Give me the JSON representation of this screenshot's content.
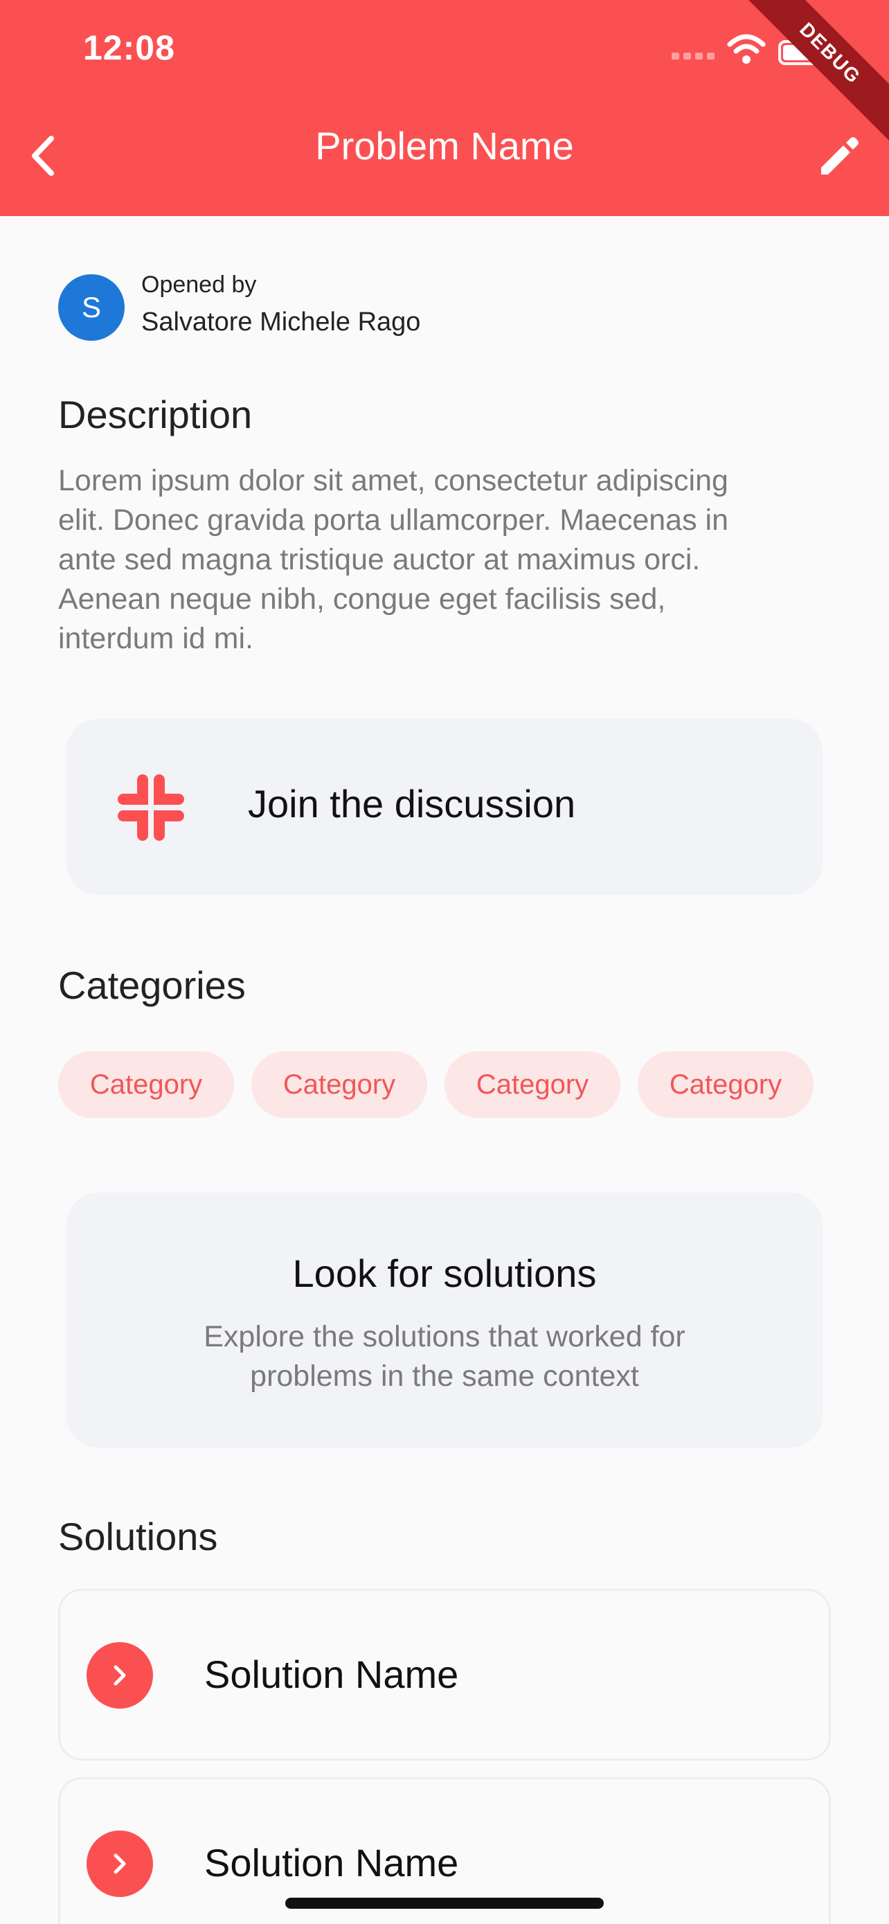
{
  "status_bar": {
    "time": "12:08"
  },
  "debug_banner": "DEBUG",
  "header": {
    "title": "Problem Name"
  },
  "opened_by": {
    "label": "Opened by",
    "avatar_initial": "S",
    "name": "Salvatore Michele Rago"
  },
  "description": {
    "title": "Description",
    "lines": [
      "Lorem ipsum dolor sit amet, consectetur adipiscing",
      "elit. Donec gravida porta ullamcorper. Maecenas in",
      "ante sed magna tristique auctor at maximus orci.",
      "Aenean neque nibh, congue eget facilisis sed,",
      "interdum id mi."
    ]
  },
  "discussion": {
    "label": "Join the discussion",
    "icon": "slack-icon"
  },
  "categories": {
    "title": "Categories",
    "items": [
      "Category",
      "Category",
      "Category",
      "Category"
    ]
  },
  "look_for_solutions": {
    "title": "Look for solutions",
    "subtitle_lines": [
      "Explore the solutions that worked for",
      "problems in the same context"
    ]
  },
  "solutions": {
    "title": "Solutions",
    "items": [
      "Solution Name",
      "Solution Name"
    ]
  },
  "colors": {
    "primary": "#fb5052",
    "chip_bg": "#fde6e6",
    "avatar": "#1e78d8",
    "card_bg": "#f2f3f7"
  }
}
